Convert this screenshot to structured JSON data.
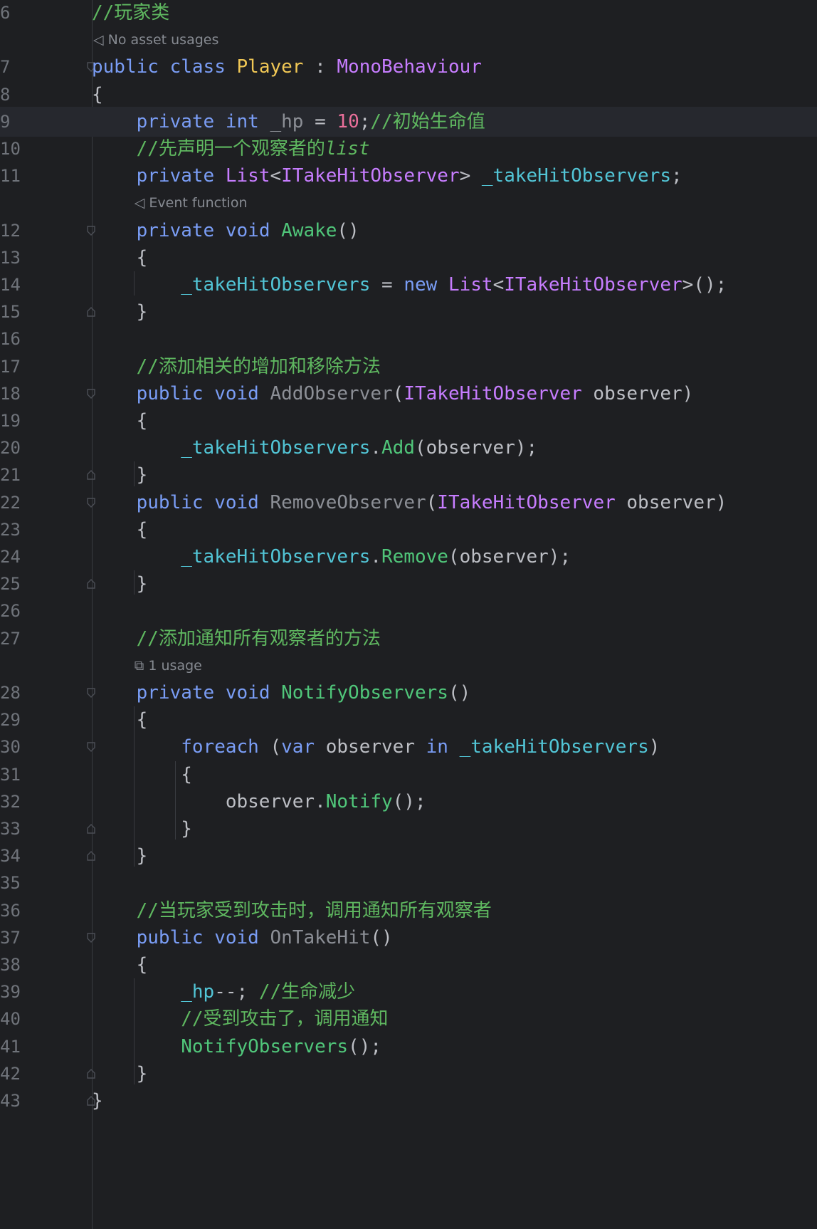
{
  "editor": {
    "lines": [
      {
        "num": "6",
        "tokens": [
          {
            "t": "//玩家类",
            "c": "cmt"
          }
        ]
      },
      {
        "hint": "No asset usages",
        "hint_icon": "unity-icon"
      },
      {
        "num": "7",
        "tokens": [
          {
            "t": "public",
            "c": "kw"
          },
          {
            "t": " "
          },
          {
            "t": "class",
            "c": "kw"
          },
          {
            "t": " "
          },
          {
            "t": "Player",
            "c": "clsname"
          },
          {
            "t": " : "
          },
          {
            "t": "MonoBehaviour",
            "c": "cls"
          }
        ],
        "fold": true
      },
      {
        "num": "8",
        "tokens": [
          {
            "t": "{"
          }
        ]
      },
      {
        "num": "9",
        "current": true,
        "tokens": [
          {
            "t": "    "
          },
          {
            "t": "private",
            "c": "kw"
          },
          {
            "t": " "
          },
          {
            "t": "int",
            "c": "kw"
          },
          {
            "t": " "
          },
          {
            "t": "_hp",
            "c": "unused"
          },
          {
            "t": " = "
          },
          {
            "t": "10",
            "c": "num"
          },
          {
            "t": ";"
          },
          {
            "t": "//初始生命值",
            "c": "cmt"
          }
        ]
      },
      {
        "num": "10",
        "tokens": [
          {
            "t": "    "
          },
          {
            "t": "//先声明一个观察者的",
            "c": "cmt"
          },
          {
            "t": "list",
            "c": "cmt ital"
          }
        ]
      },
      {
        "num": "11",
        "tokens": [
          {
            "t": "    "
          },
          {
            "t": "private",
            "c": "kw"
          },
          {
            "t": " "
          },
          {
            "t": "List",
            "c": "cls"
          },
          {
            "t": "<"
          },
          {
            "t": "ITakeHitObserver",
            "c": "cls"
          },
          {
            "t": "> "
          },
          {
            "t": "_takeHitObservers",
            "c": "fld"
          },
          {
            "t": ";"
          }
        ]
      },
      {
        "hint": "Event function",
        "hint_icon": "unity-icon",
        "indent": 1
      },
      {
        "num": "12",
        "tokens": [
          {
            "t": "    "
          },
          {
            "t": "private",
            "c": "kw"
          },
          {
            "t": " "
          },
          {
            "t": "void",
            "c": "kw"
          },
          {
            "t": " "
          },
          {
            "t": "Awake",
            "c": "mth"
          },
          {
            "t": "()"
          }
        ],
        "fold": true
      },
      {
        "num": "13",
        "tokens": [
          {
            "t": "    {"
          }
        ]
      },
      {
        "num": "14",
        "tokens": [
          {
            "t": "        "
          },
          {
            "t": "_takeHitObservers",
            "c": "fld"
          },
          {
            "t": " = "
          },
          {
            "t": "new",
            "c": "kw"
          },
          {
            "t": " "
          },
          {
            "t": "List",
            "c": "cls"
          },
          {
            "t": "<"
          },
          {
            "t": "ITakeHitObserver",
            "c": "cls"
          },
          {
            "t": ">();"
          }
        ]
      },
      {
        "num": "15",
        "tokens": [
          {
            "t": "    }"
          }
        ],
        "foldend": true
      },
      {
        "num": "16",
        "tokens": []
      },
      {
        "num": "17",
        "tokens": [
          {
            "t": "    "
          },
          {
            "t": "//添加相关的增加和移除方法",
            "c": "cmt"
          }
        ]
      },
      {
        "num": "18",
        "tokens": [
          {
            "t": "    "
          },
          {
            "t": "public",
            "c": "kw"
          },
          {
            "t": " "
          },
          {
            "t": "void",
            "c": "kw"
          },
          {
            "t": " "
          },
          {
            "t": "AddObserver",
            "c": "unused"
          },
          {
            "t": "("
          },
          {
            "t": "ITakeHitObserver",
            "c": "cls"
          },
          {
            "t": " observer)"
          }
        ],
        "fold": true
      },
      {
        "num": "19",
        "tokens": [
          {
            "t": "    {"
          }
        ]
      },
      {
        "num": "20",
        "tokens": [
          {
            "t": "        "
          },
          {
            "t": "_takeHitObservers",
            "c": "fld"
          },
          {
            "t": "."
          },
          {
            "t": "Add",
            "c": "mth"
          },
          {
            "t": "(observer);"
          }
        ]
      },
      {
        "num": "21",
        "tokens": [
          {
            "t": "    }"
          }
        ],
        "foldend": true
      },
      {
        "num": "22",
        "tokens": [
          {
            "t": "    "
          },
          {
            "t": "public",
            "c": "kw"
          },
          {
            "t": " "
          },
          {
            "t": "void",
            "c": "kw"
          },
          {
            "t": " "
          },
          {
            "t": "RemoveObserver",
            "c": "unused"
          },
          {
            "t": "("
          },
          {
            "t": "ITakeHitObserver",
            "c": "cls"
          },
          {
            "t": " observer)"
          }
        ],
        "fold": true
      },
      {
        "num": "23",
        "tokens": [
          {
            "t": "    {"
          }
        ]
      },
      {
        "num": "24",
        "tokens": [
          {
            "t": "        "
          },
          {
            "t": "_takeHitObservers",
            "c": "fld"
          },
          {
            "t": "."
          },
          {
            "t": "Remove",
            "c": "mth"
          },
          {
            "t": "(observer);"
          }
        ]
      },
      {
        "num": "25",
        "tokens": [
          {
            "t": "    }"
          }
        ],
        "foldend": true
      },
      {
        "num": "26",
        "tokens": []
      },
      {
        "num": "27",
        "tokens": [
          {
            "t": "    "
          },
          {
            "t": "//添加通知所有观察者的方法",
            "c": "cmt"
          }
        ]
      },
      {
        "hint": "1 usage",
        "hint_icon": "usage-icon",
        "indent": 1
      },
      {
        "num": "28",
        "tokens": [
          {
            "t": "    "
          },
          {
            "t": "private",
            "c": "kw"
          },
          {
            "t": " "
          },
          {
            "t": "void",
            "c": "kw"
          },
          {
            "t": " "
          },
          {
            "t": "NotifyObservers",
            "c": "mth"
          },
          {
            "t": "()"
          }
        ],
        "fold": true
      },
      {
        "num": "29",
        "tokens": [
          {
            "t": "    {"
          }
        ]
      },
      {
        "num": "30",
        "tokens": [
          {
            "t": "        "
          },
          {
            "t": "foreach",
            "c": "kw"
          },
          {
            "t": " ("
          },
          {
            "t": "var",
            "c": "kw"
          },
          {
            "t": " observer "
          },
          {
            "t": "in",
            "c": "kw"
          },
          {
            "t": " "
          },
          {
            "t": "_takeHitObservers",
            "c": "fld"
          },
          {
            "t": ")"
          }
        ],
        "fold": true
      },
      {
        "num": "31",
        "tokens": [
          {
            "t": "        {"
          }
        ]
      },
      {
        "num": "32",
        "tokens": [
          {
            "t": "            observer."
          },
          {
            "t": "Notify",
            "c": "mth"
          },
          {
            "t": "();"
          }
        ]
      },
      {
        "num": "33",
        "tokens": [
          {
            "t": "        }"
          }
        ],
        "foldend": true
      },
      {
        "num": "34",
        "tokens": [
          {
            "t": "    }"
          }
        ],
        "foldend": true
      },
      {
        "num": "35",
        "tokens": []
      },
      {
        "num": "36",
        "tokens": [
          {
            "t": "    "
          },
          {
            "t": "//当玩家受到攻击时，调用通知所有观察者",
            "c": "cmt"
          }
        ]
      },
      {
        "num": "37",
        "tokens": [
          {
            "t": "    "
          },
          {
            "t": "public",
            "c": "kw"
          },
          {
            "t": " "
          },
          {
            "t": "void",
            "c": "kw"
          },
          {
            "t": " "
          },
          {
            "t": "OnTakeHit",
            "c": "unused"
          },
          {
            "t": "()"
          }
        ],
        "fold": true
      },
      {
        "num": "38",
        "tokens": [
          {
            "t": "    {"
          }
        ]
      },
      {
        "num": "39",
        "tokens": [
          {
            "t": "        "
          },
          {
            "t": "_hp",
            "c": "fld"
          },
          {
            "t": "--; "
          },
          {
            "t": "//生命减少",
            "c": "cmt"
          }
        ]
      },
      {
        "num": "40",
        "tokens": [
          {
            "t": "        "
          },
          {
            "t": "//受到攻击了，调用通知",
            "c": "cmt"
          }
        ]
      },
      {
        "num": "41",
        "tokens": [
          {
            "t": "        "
          },
          {
            "t": "NotifyObservers",
            "c": "mth"
          },
          {
            "t": "();"
          }
        ]
      },
      {
        "num": "42",
        "tokens": [
          {
            "t": "    }"
          }
        ],
        "foldend": true
      },
      {
        "num": "43",
        "tokens": [
          {
            "t": "}"
          }
        ],
        "foldend": true
      }
    ]
  },
  "colors": {
    "background": "#1e1f22",
    "keyword": "#7a9df5",
    "type": "#c77dff",
    "comment": "#5fb860",
    "number": "#ea6f9a",
    "field": "#52c5d6",
    "method": "#50c67a",
    "class_name": "#f0c755"
  }
}
